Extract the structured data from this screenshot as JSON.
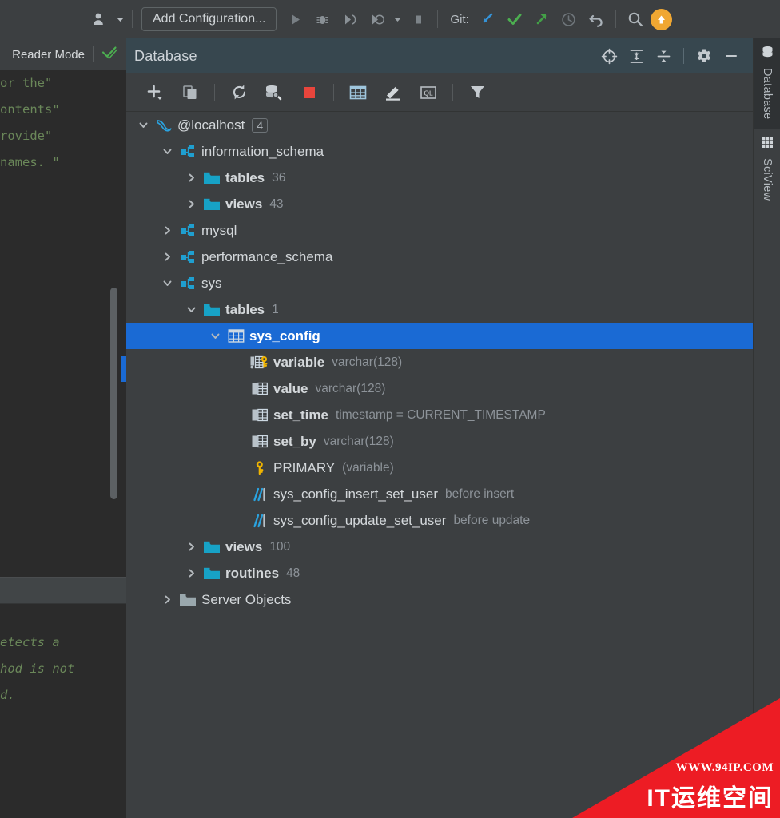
{
  "main_toolbar": {
    "avatar_icon": "user-avatar-icon",
    "avatar_dropdown_icon": "chevron-down-icon",
    "add_configuration_label": "Add Configuration...",
    "run_icon": "run-icon",
    "debug_icon": "debug-icon",
    "run_coverage_icon": "run-with-coverage-icon",
    "profile_icon": "profile-icon",
    "profile_dropdown_icon": "chevron-down-icon",
    "stop_icon": "stop-icon",
    "git_label": "Git:",
    "git_update_icon": "update-project-icon",
    "git_commit_icon": "commit-icon",
    "git_push_icon": "push-icon",
    "git_history_icon": "history-icon",
    "git_rollback_icon": "rollback-icon",
    "search_icon": "search-everywhere-icon",
    "update_badge_icon": "arrow-up-badge-icon"
  },
  "editor": {
    "reader_mode_label": "Reader Mode",
    "inspection_icon": "inspection-ok-icon",
    "code_lines": [
      {
        "text": "or the\"",
        "italic": false
      },
      {
        "text": "",
        "italic": false
      },
      {
        "text": "ontents\"",
        "italic": false
      },
      {
        "text": "rovide\"",
        "italic": false
      },
      {
        "text": "",
        "italic": false
      },
      {
        "text": "",
        "italic": false
      },
      {
        "text": "",
        "italic": false
      },
      {
        "text": "",
        "italic": false
      },
      {
        "text": " names. \"",
        "italic": false
      }
    ],
    "code_lines_lower": [
      {
        "text": "etects a",
        "italic": true
      },
      {
        "text": "hod is not",
        "italic": true
      },
      {
        "text": "d.",
        "italic": true
      }
    ]
  },
  "database_panel": {
    "title": "Database",
    "header_icons": [
      {
        "name": "scroll-from-source-icon"
      },
      {
        "name": "expand-all-icon"
      },
      {
        "name": "collapse-all-icon"
      },
      {
        "name": "settings-gear-icon"
      },
      {
        "name": "hide-panel-icon"
      }
    ],
    "toolbar_icons": [
      {
        "name": "add-icon"
      },
      {
        "name": "duplicate-icon"
      },
      {
        "name": "refresh-icon"
      },
      {
        "name": "data-source-properties-icon"
      },
      {
        "name": "stop-icon"
      },
      {
        "name": "open-table-editor-icon"
      },
      {
        "name": "modify-table-icon"
      },
      {
        "name": "open-query-console-icon"
      },
      {
        "name": "filter-icon"
      }
    ]
  },
  "tree": {
    "rows": [
      {
        "indent": 0,
        "twisty": "down",
        "icon": "mysql-dolphin-icon",
        "label": "@localhost",
        "sub": "4",
        "badge": true,
        "selected": false,
        "bold": false
      },
      {
        "indent": 1,
        "twisty": "down",
        "icon": "schema-icon",
        "label": "information_schema",
        "sub": "",
        "badge": false,
        "selected": false,
        "bold": false
      },
      {
        "indent": 2,
        "twisty": "right",
        "icon": "folder-icon",
        "label": "tables",
        "sub": "36",
        "badge": false,
        "selected": false,
        "bold": true
      },
      {
        "indent": 2,
        "twisty": "right",
        "icon": "folder-icon",
        "label": "views",
        "sub": "43",
        "badge": false,
        "selected": false,
        "bold": true
      },
      {
        "indent": 1,
        "twisty": "right",
        "icon": "schema-icon",
        "label": "mysql",
        "sub": "",
        "badge": false,
        "selected": false,
        "bold": false
      },
      {
        "indent": 1,
        "twisty": "right",
        "icon": "schema-icon",
        "label": "performance_schema",
        "sub": "",
        "badge": false,
        "selected": false,
        "bold": false
      },
      {
        "indent": 1,
        "twisty": "down",
        "icon": "schema-icon",
        "label": "sys",
        "sub": "",
        "badge": false,
        "selected": false,
        "bold": false
      },
      {
        "indent": 2,
        "twisty": "down",
        "icon": "folder-icon",
        "label": "tables",
        "sub": "1",
        "badge": false,
        "selected": false,
        "bold": true
      },
      {
        "indent": 3,
        "twisty": "down",
        "icon": "table-icon",
        "label": "sys_config",
        "sub": "",
        "badge": false,
        "selected": true,
        "bold": true
      },
      {
        "indent": 4,
        "twisty": "none",
        "icon": "primary-key-column-icon",
        "label": "variable",
        "sub": "varchar(128)",
        "badge": false,
        "selected": false,
        "bold": true
      },
      {
        "indent": 4,
        "twisty": "none",
        "icon": "column-icon",
        "label": "value",
        "sub": "varchar(128)",
        "badge": false,
        "selected": false,
        "bold": true
      },
      {
        "indent": 4,
        "twisty": "none",
        "icon": "column-icon",
        "label": "set_time",
        "sub": "timestamp = CURRENT_TIMESTAMP",
        "badge": false,
        "selected": false,
        "bold": true
      },
      {
        "indent": 4,
        "twisty": "none",
        "icon": "column-icon",
        "label": "set_by",
        "sub": "varchar(128)",
        "badge": false,
        "selected": false,
        "bold": true
      },
      {
        "indent": 4,
        "twisty": "none",
        "icon": "key-icon",
        "label": "PRIMARY",
        "sub": "(variable)",
        "badge": false,
        "selected": false,
        "bold": false
      },
      {
        "indent": 4,
        "twisty": "none",
        "icon": "trigger-icon",
        "label": "sys_config_insert_set_user",
        "sub": "before insert",
        "badge": false,
        "selected": false,
        "bold": false
      },
      {
        "indent": 4,
        "twisty": "none",
        "icon": "trigger-icon",
        "label": "sys_config_update_set_user",
        "sub": "before update",
        "badge": false,
        "selected": false,
        "bold": false
      },
      {
        "indent": 2,
        "twisty": "right",
        "icon": "folder-icon",
        "label": "views",
        "sub": "100",
        "badge": false,
        "selected": false,
        "bold": true
      },
      {
        "indent": 2,
        "twisty": "right",
        "icon": "folder-icon",
        "label": "routines",
        "sub": "48",
        "badge": false,
        "selected": false,
        "bold": true
      },
      {
        "indent": 1,
        "twisty": "right",
        "icon": "folder-gray-icon",
        "label": "Server Objects",
        "sub": "",
        "badge": false,
        "selected": false,
        "bold": false
      }
    ]
  },
  "right_strip": {
    "tabs": [
      {
        "label": "Database",
        "icon": "database-stack-icon",
        "active": true
      },
      {
        "label": "SciView",
        "icon": "sciview-grid-icon",
        "active": false
      }
    ]
  },
  "watermark": {
    "url": "WWW.94IP.COM",
    "text": "IT运维空间",
    "color": "#ed1c24"
  },
  "colors": {
    "selection_blue": "#1a6ad4",
    "panel_header": "#37474f",
    "panel_bg": "#3c3f41",
    "editor_bg": "#2b2b2b",
    "folder_teal": "#21a0c4",
    "key_yellow": "#f0b400"
  }
}
